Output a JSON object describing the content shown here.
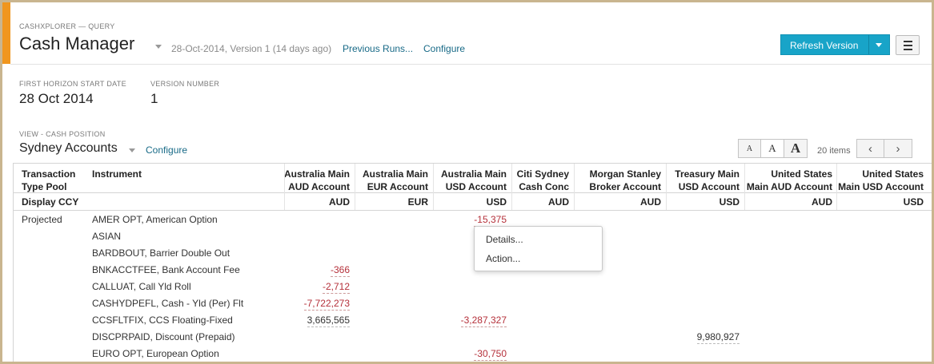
{
  "header": {
    "app_label": "CASHXPLORER — QUERY",
    "title": "Cash Manager",
    "version_info": "28-Oct-2014, Version 1 (14 days ago)",
    "previous_runs": "Previous Runs...",
    "configure": "Configure",
    "refresh_label": "Refresh Version"
  },
  "meta": {
    "horizon_label": "FIRST HORIZON START DATE",
    "horizon_value": "28 Oct 2014",
    "version_label": "VERSION NUMBER",
    "version_value": "1"
  },
  "view": {
    "label": "VIEW - CASH POSITION",
    "title": "Sydney Accounts",
    "configure": "Configure",
    "font_small": "A",
    "font_medium": "A",
    "font_large": "A",
    "items_count": "20 items",
    "prev_icon": "‹",
    "next_icon": "›"
  },
  "table": {
    "columns": [
      {
        "l1": "Transaction",
        "l2": "Type Pool"
      },
      {
        "l1": "Instrument",
        "l2": ""
      },
      {
        "l1": "Australia Main",
        "l2": "AUD Account"
      },
      {
        "l1": "Australia Main",
        "l2": "EUR Account"
      },
      {
        "l1": "Australia Main",
        "l2": "USD Account"
      },
      {
        "l1": "Citi Sydney",
        "l2": "Cash Conc"
      },
      {
        "l1": "Morgan Stanley",
        "l2": "Broker Account"
      },
      {
        "l1": "Treasury Main",
        "l2": "USD Account"
      },
      {
        "l1": "United States",
        "l2": "Main AUD Account"
      },
      {
        "l1": "United States",
        "l2": "Main USD Account"
      }
    ],
    "ccy_label": "Display CCY",
    "ccy": [
      "AUD",
      "EUR",
      "USD",
      "AUD",
      "AUD",
      "USD",
      "AUD",
      "USD"
    ],
    "pool": "Projected",
    "rows": [
      {
        "instrument": "AMER OPT, American Option",
        "values": [
          "",
          "",
          "-15,375",
          "",
          "",
          "",
          "",
          ""
        ]
      },
      {
        "instrument": "ASIAN",
        "values": [
          "",
          "",
          "",
          "",
          "",
          "",
          "",
          ""
        ]
      },
      {
        "instrument": "BARDBOUT, Barrier Double Out",
        "values": [
          "",
          "",
          "",
          "",
          "",
          "",
          "",
          ""
        ]
      },
      {
        "instrument": "BNKACCTFEE, Bank Account Fee",
        "values": [
          "-366",
          "",
          "",
          "",
          "",
          "",
          "",
          ""
        ]
      },
      {
        "instrument": "CALLUAT, Call Yld Roll",
        "values": [
          "-2,712",
          "",
          "",
          "",
          "",
          "",
          "",
          ""
        ]
      },
      {
        "instrument": "CASHYDPEFL, Cash - Yld (Per) Flt",
        "values": [
          "-7,722,273",
          "",
          "",
          "",
          "",
          "",
          "",
          ""
        ]
      },
      {
        "instrument": "CCSFLTFIX, CCS Floating-Fixed",
        "values": [
          "3,665,565",
          "",
          "-3,287,327",
          "",
          "",
          "",
          "",
          ""
        ]
      },
      {
        "instrument": "DISCPRPAID, Discount (Prepaid)",
        "values": [
          "",
          "",
          "",
          "",
          "",
          "9,980,927",
          "",
          ""
        ]
      },
      {
        "instrument": "EURO OPT, European Option",
        "values": [
          "",
          "",
          "-30,750",
          "",
          "",
          "",
          "",
          ""
        ]
      }
    ]
  },
  "context_menu": {
    "items": [
      "Details...",
      "Action..."
    ]
  },
  "colors": {
    "accent": "#f0961e",
    "primary_button": "#18a4c8",
    "link": "#186a87",
    "negative": "#b5303a"
  }
}
